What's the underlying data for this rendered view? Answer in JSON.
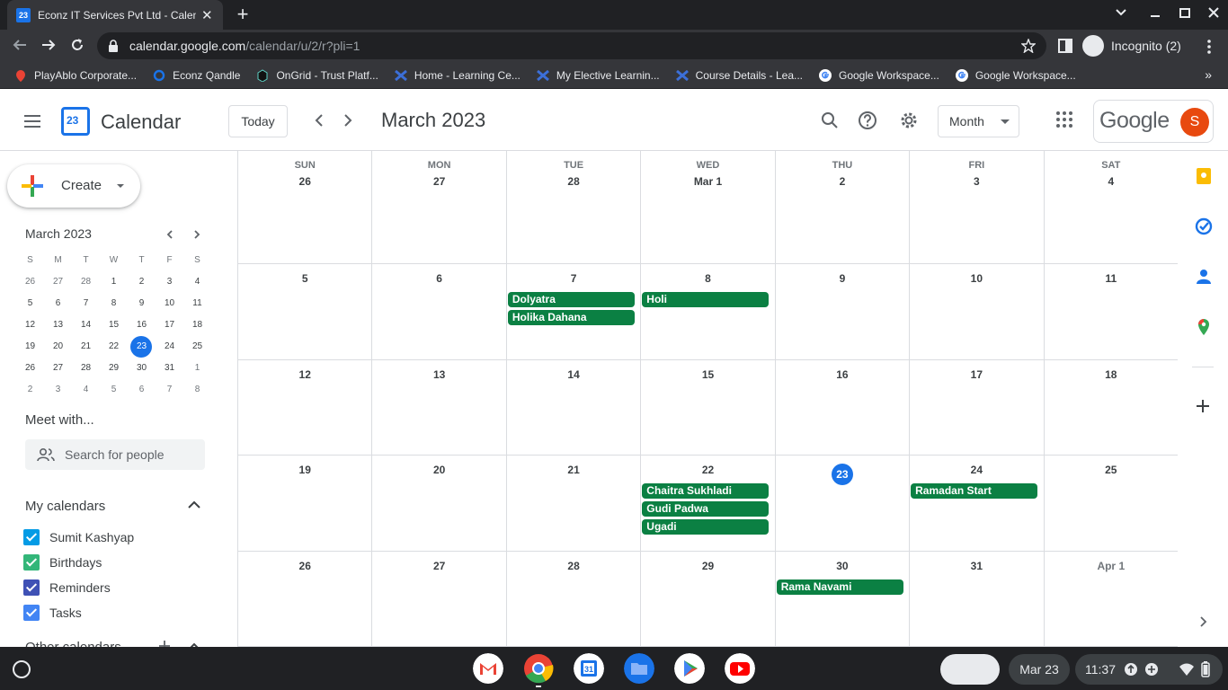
{
  "browser": {
    "tab_title": "Econz IT Services Pvt Ltd - Calendar",
    "tab_favicon": "23",
    "url_host": "calendar.google.com",
    "url_path": "/calendar/u/2/r?pli=1",
    "profile": "Incognito (2)",
    "bookmarks": [
      "PlayAblo Corporate...",
      "Econz Qandle",
      "OnGrid - Trust Platf...",
      "Home - Learning Ce...",
      "My Elective Learnin...",
      "Course Details - Lea...",
      "Google Workspace...",
      "Google Workspace..."
    ]
  },
  "header": {
    "app_title": "Calendar",
    "logo_day": "23",
    "today_label": "Today",
    "month_title": "March 2023",
    "view_label": "Month",
    "google_label": "Google",
    "avatar_letter": "S"
  },
  "sidebar": {
    "create_label": "Create",
    "mini_title": "March 2023",
    "mini_dow": [
      "S",
      "M",
      "T",
      "W",
      "T",
      "F",
      "S"
    ],
    "mini_weeks": [
      [
        "26",
        "27",
        "28",
        "1",
        "2",
        "3",
        "4"
      ],
      [
        "5",
        "6",
        "7",
        "8",
        "9",
        "10",
        "11"
      ],
      [
        "12",
        "13",
        "14",
        "15",
        "16",
        "17",
        "18"
      ],
      [
        "19",
        "20",
        "21",
        "22",
        "23",
        "24",
        "25"
      ],
      [
        "26",
        "27",
        "28",
        "29",
        "30",
        "31",
        "1"
      ],
      [
        "2",
        "3",
        "4",
        "5",
        "6",
        "7",
        "8"
      ]
    ],
    "meet_title": "Meet with...",
    "people_placeholder": "Search for people",
    "my_calendars_title": "My calendars",
    "calendars": [
      {
        "name": "Sumit Kashyap",
        "color": "#039be5"
      },
      {
        "name": "Birthdays",
        "color": "#33b679"
      },
      {
        "name": "Reminders",
        "color": "#3f51b5"
      },
      {
        "name": "Tasks",
        "color": "#4285f4"
      }
    ],
    "other_calendars_title": "Other calendars"
  },
  "grid": {
    "dow": [
      "SUN",
      "MON",
      "TUE",
      "WED",
      "THU",
      "FRI",
      "SAT"
    ],
    "weeks": [
      [
        {
          "d": "26"
        },
        {
          "d": "27"
        },
        {
          "d": "28"
        },
        {
          "d": "Mar 1"
        },
        {
          "d": "2"
        },
        {
          "d": "3"
        },
        {
          "d": "4"
        }
      ],
      [
        {
          "d": "5"
        },
        {
          "d": "6"
        },
        {
          "d": "7",
          "events": [
            "Dolyatra",
            "Holika Dahana"
          ]
        },
        {
          "d": "8",
          "events": [
            "Holi"
          ]
        },
        {
          "d": "9"
        },
        {
          "d": "10"
        },
        {
          "d": "11"
        }
      ],
      [
        {
          "d": "12"
        },
        {
          "d": "13"
        },
        {
          "d": "14"
        },
        {
          "d": "15"
        },
        {
          "d": "16"
        },
        {
          "d": "17"
        },
        {
          "d": "18"
        }
      ],
      [
        {
          "d": "19"
        },
        {
          "d": "20"
        },
        {
          "d": "21"
        },
        {
          "d": "22",
          "events": [
            "Chaitra Sukhladi",
            "Gudi Padwa",
            "Ugadi"
          ]
        },
        {
          "d": "23",
          "today": true
        },
        {
          "d": "24",
          "events": [
            "Ramadan Start"
          ]
        },
        {
          "d": "25"
        }
      ],
      [
        {
          "d": "26"
        },
        {
          "d": "27"
        },
        {
          "d": "28"
        },
        {
          "d": "29"
        },
        {
          "d": "30",
          "events": [
            "Rama Navami"
          ]
        },
        {
          "d": "31"
        },
        {
          "d": "Apr 1",
          "out": true
        }
      ]
    ],
    "event_color": "#0b8043",
    "today_color": "#1a73e8"
  },
  "shelf": {
    "date": "Mar 23",
    "time": "11:37"
  }
}
